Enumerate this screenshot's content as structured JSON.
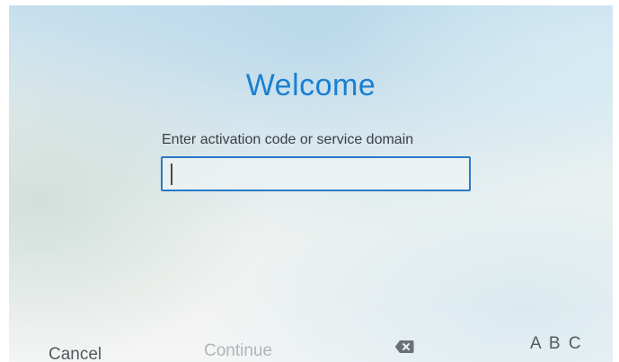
{
  "welcome": {
    "title": "Welcome",
    "prompt": "Enter activation code or service domain",
    "field_value": ""
  },
  "softkeys": {
    "cancel": "Cancel",
    "continue": "Continue",
    "abc": "A B C"
  },
  "icons": {
    "backspace": "backspace-icon"
  },
  "colors": {
    "title": "#1a7fd0",
    "field_border": "#2a78c6",
    "softkey_text": "#55595d",
    "softkey_disabled": "#aeb6bb"
  }
}
